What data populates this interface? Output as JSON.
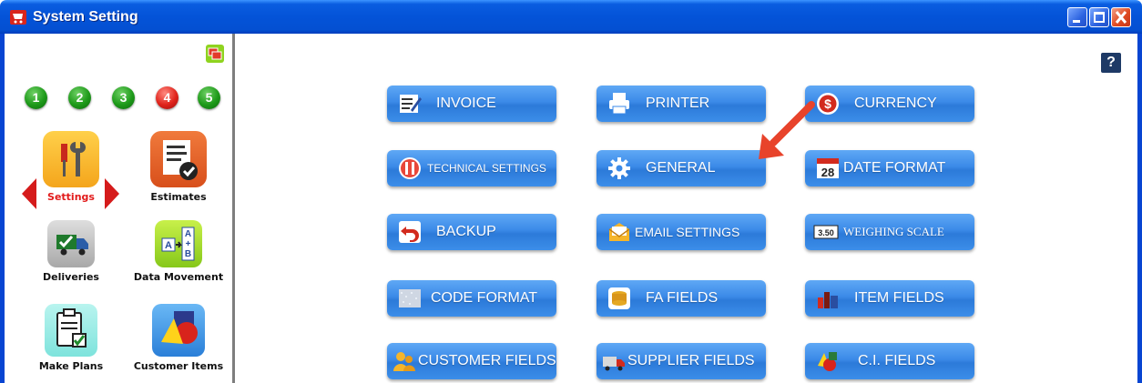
{
  "window": {
    "title": "System Setting",
    "icon": "cart-icon",
    "controls": [
      "minimize-icon",
      "maximize-icon",
      "close-icon"
    ]
  },
  "sidebar": {
    "steps": [
      {
        "label": "1",
        "color": "#1e9a1a"
      },
      {
        "label": "2",
        "color": "#1e9a1a"
      },
      {
        "label": "3",
        "color": "#1e9a1a"
      },
      {
        "label": "4",
        "color": "#e0231b"
      },
      {
        "label": "5",
        "color": "#1e9a1a"
      }
    ],
    "modules": [
      {
        "label": "Settings",
        "icon": "tools-icon",
        "active": true
      },
      {
        "label": "Estimates",
        "icon": "checklist-icon",
        "active": false
      },
      {
        "label": "Deliveries",
        "icon": "truck-icon",
        "active": false
      },
      {
        "label": "Data Movement",
        "icon": "a-to-b-icon",
        "active": false
      },
      {
        "label": "Make Plans",
        "icon": "clipboard-check-icon",
        "active": false
      },
      {
        "label": "Customer Items",
        "icon": "shapes-icon",
        "active": false
      }
    ],
    "active_color": "#e21b1b"
  },
  "main": {
    "help_label": "?",
    "buttons": [
      {
        "label": "INVOICE",
        "icon": "invoice-pen-icon"
      },
      {
        "label": "PRINTER",
        "icon": "printer-icon"
      },
      {
        "label": "CURRENCY",
        "icon": "dollar-icon"
      },
      {
        "label": "TECHNICAL SETTINGS",
        "icon": "tools-icon"
      },
      {
        "label": "GENERAL",
        "icon": "gear-icon"
      },
      {
        "label": "DATE FORMAT",
        "icon": "calendar-icon",
        "day": "28"
      },
      {
        "label": "BACKUP",
        "icon": "undo-arrow-icon"
      },
      {
        "label": "EMAIL SETTINGS",
        "icon": "envelope-icon"
      },
      {
        "label": "WEIGHING SCALE",
        "icon": "scale-display-icon",
        "badge": "3.50"
      },
      {
        "label": "CODE FORMAT",
        "icon": "code-pattern-icon"
      },
      {
        "label": "FA FIELDS",
        "icon": "coins-icon"
      },
      {
        "label": "ITEM FIELDS",
        "icon": "bottles-icon"
      },
      {
        "label": "CUSTOMER FIELDS",
        "icon": "customers-icon"
      },
      {
        "label": "SUPPLIER FIELDS",
        "icon": "supplier-truck-icon"
      },
      {
        "label": "C.I. FIELDS",
        "icon": "shapes-icon"
      }
    ],
    "button_color": "#3b8ae8",
    "pointer_arrow_color": "#e8432b"
  }
}
